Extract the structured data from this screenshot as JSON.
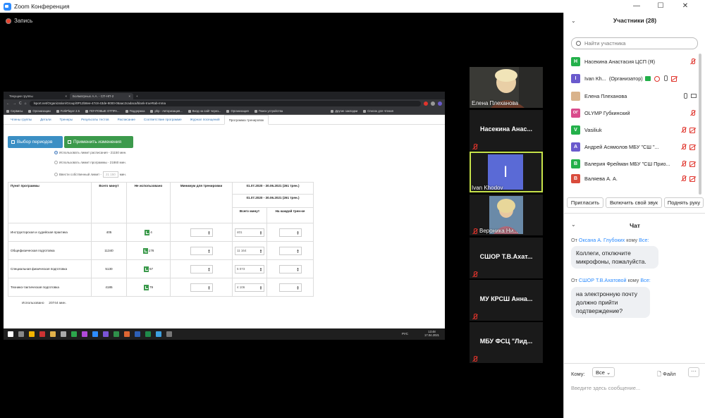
{
  "window": {
    "title": "Zoom Конференция",
    "minimize": "—",
    "maximize": "☐",
    "close": "✕"
  },
  "recording": {
    "label": "Запись"
  },
  "browser": {
    "tabs": [
      {
        "label": "Текущие группы",
        "close": "×"
      },
      {
        "label": "Болматрных А.А. - СП-НП-2",
        "close": "×"
      },
      {
        "label": "+"
      }
    ],
    "nav": {
      "back": "←",
      "forward": "→",
      "reload": "C",
      "home": "⌂"
    },
    "url": "lsport.net/Organization/Group/0P12b8ee-47c8-43de-9000-06aac2cadaca/blank-true#tab-mma",
    "bookmarks": [
      "Сервисы",
      "Организации",
      "ForkPlayer 2.5",
      "ПОЧТОВЫЕ ОТПРА...",
      "Поддержка",
      "php - Авторизация...",
      "Вход на сайт через...",
      "Организация",
      "Поиск устройства",
      "Другие закладки",
      "Список для чтения"
    ]
  },
  "page": {
    "tabs": [
      "Члены группы",
      "Детали",
      "Тренеры",
      "Результаты тестов",
      "Расписание",
      "Соответствие программе",
      "Журнал посещений",
      "Программа тренировок"
    ],
    "buttons": {
      "select_periods": "Выбор периодов",
      "apply_changes": "Применить изменения"
    },
    "options": {
      "schedule_limit": "Использовать лимит расписания - 21150 мин.",
      "program_limit": "Использовать лимит программы - 21860 мин.",
      "own_limit": "Ввести собственный лимит -",
      "own_limit_value": "21 150",
      "unit": "мин."
    },
    "table": {
      "headers": {
        "item": "Пункт программы",
        "total": "Всего минут",
        "unused": "Не использовано",
        "minimum": "Минимум для тренировки",
        "period1": "01.07.2020 - 30.06.2021 (261 трен.)",
        "period2": "01.07.2020 - 30.06.2021 (261 трен.)",
        "sub_total": "Всего минут",
        "sub_each": "На каждой трен-ке"
      },
      "rows": [
        {
          "name": "Инструкторская и судейская практика",
          "total": "405",
          "unused": "4",
          "minutes": "401"
        },
        {
          "name": "Общефизическая подготовка",
          "total": "11340",
          "unused": "176",
          "minutes": "11 164"
        },
        {
          "name": "Специальная физическая подготовка",
          "total": "5130",
          "unused": "57",
          "minutes": "5 073"
        },
        {
          "name": "Технико-тактическая подготовка",
          "total": "4185",
          "unused": "79",
          "minutes": "4 106"
        }
      ],
      "spin_up": "▲",
      "spin_down": "▼"
    },
    "used": {
      "label": "Использовано",
      "value": "20744 мин."
    }
  },
  "taskbar": {
    "lang": "РУС",
    "time": "13:48",
    "date": "17.04.2021"
  },
  "videos": [
    {
      "name": "Елена Плеханова"
    },
    {
      "name": "Насекина Анас..."
    },
    {
      "name": "Ivan Khodov",
      "initial": "I"
    },
    {
      "name": "Вероника Ни..."
    },
    {
      "name": "СШОР Т.В.Ахат..."
    },
    {
      "name": "МУ КРСШ Анна..."
    },
    {
      "name": "МБУ ФСЦ \"Лид..."
    }
  ],
  "participants": {
    "title": "Участники (28)",
    "search_placeholder": "Найти участника",
    "list": [
      {
        "initial": "Н",
        "name": "Насекина Анастасия ЦСП (Я)",
        "color": "#23b04a"
      },
      {
        "initial": "I",
        "name": "Ivan Kh...",
        "role": "(Организатор)",
        "color": "#6a5acd"
      },
      {
        "initial": "",
        "name": "Елена Плеханова",
        "color": "#d9b38c"
      },
      {
        "initial": "ОГ",
        "name": "OLYMP Губкинский",
        "color": "#d94b8c"
      },
      {
        "initial": "V",
        "name": "Vasiliuk",
        "color": "#23b04a"
      },
      {
        "initial": "А",
        "name": "Андрей Асямолов МБУ \"СШ \"...",
        "color": "#6a5acd"
      },
      {
        "initial": "В",
        "name": "Валерия Фрейман МБУ \"СШ Прио...",
        "color": "#23b04a"
      },
      {
        "initial": "В",
        "name": "Валяева А. А.",
        "color": "#d94b3c"
      }
    ],
    "buttons": {
      "invite": "Пригласить",
      "unmute": "Включить свой звук",
      "raise_hand": "Поднять руку"
    }
  },
  "chat": {
    "title": "Чат",
    "messages": [
      {
        "from_prefix": "От",
        "sender": "Оксана А. Глубоких",
        "to_word": "кому",
        "to": "Все:",
        "text_lines": [
          "Коллеги, отключите",
          "микрофоны, пожалуйста."
        ]
      },
      {
        "from_prefix": "От",
        "sender": "СШОР Т.В.Ахатовой",
        "to_word": "кому",
        "to": "Все:",
        "text_lines": [
          "на электронную почту",
          "должно прийти",
          "подтверждение?"
        ]
      }
    ],
    "to_label": "Кому:",
    "to_value": "Все",
    "file_label": "Файл",
    "more": "···",
    "input_placeholder": "Введите здесь сообщение..."
  }
}
